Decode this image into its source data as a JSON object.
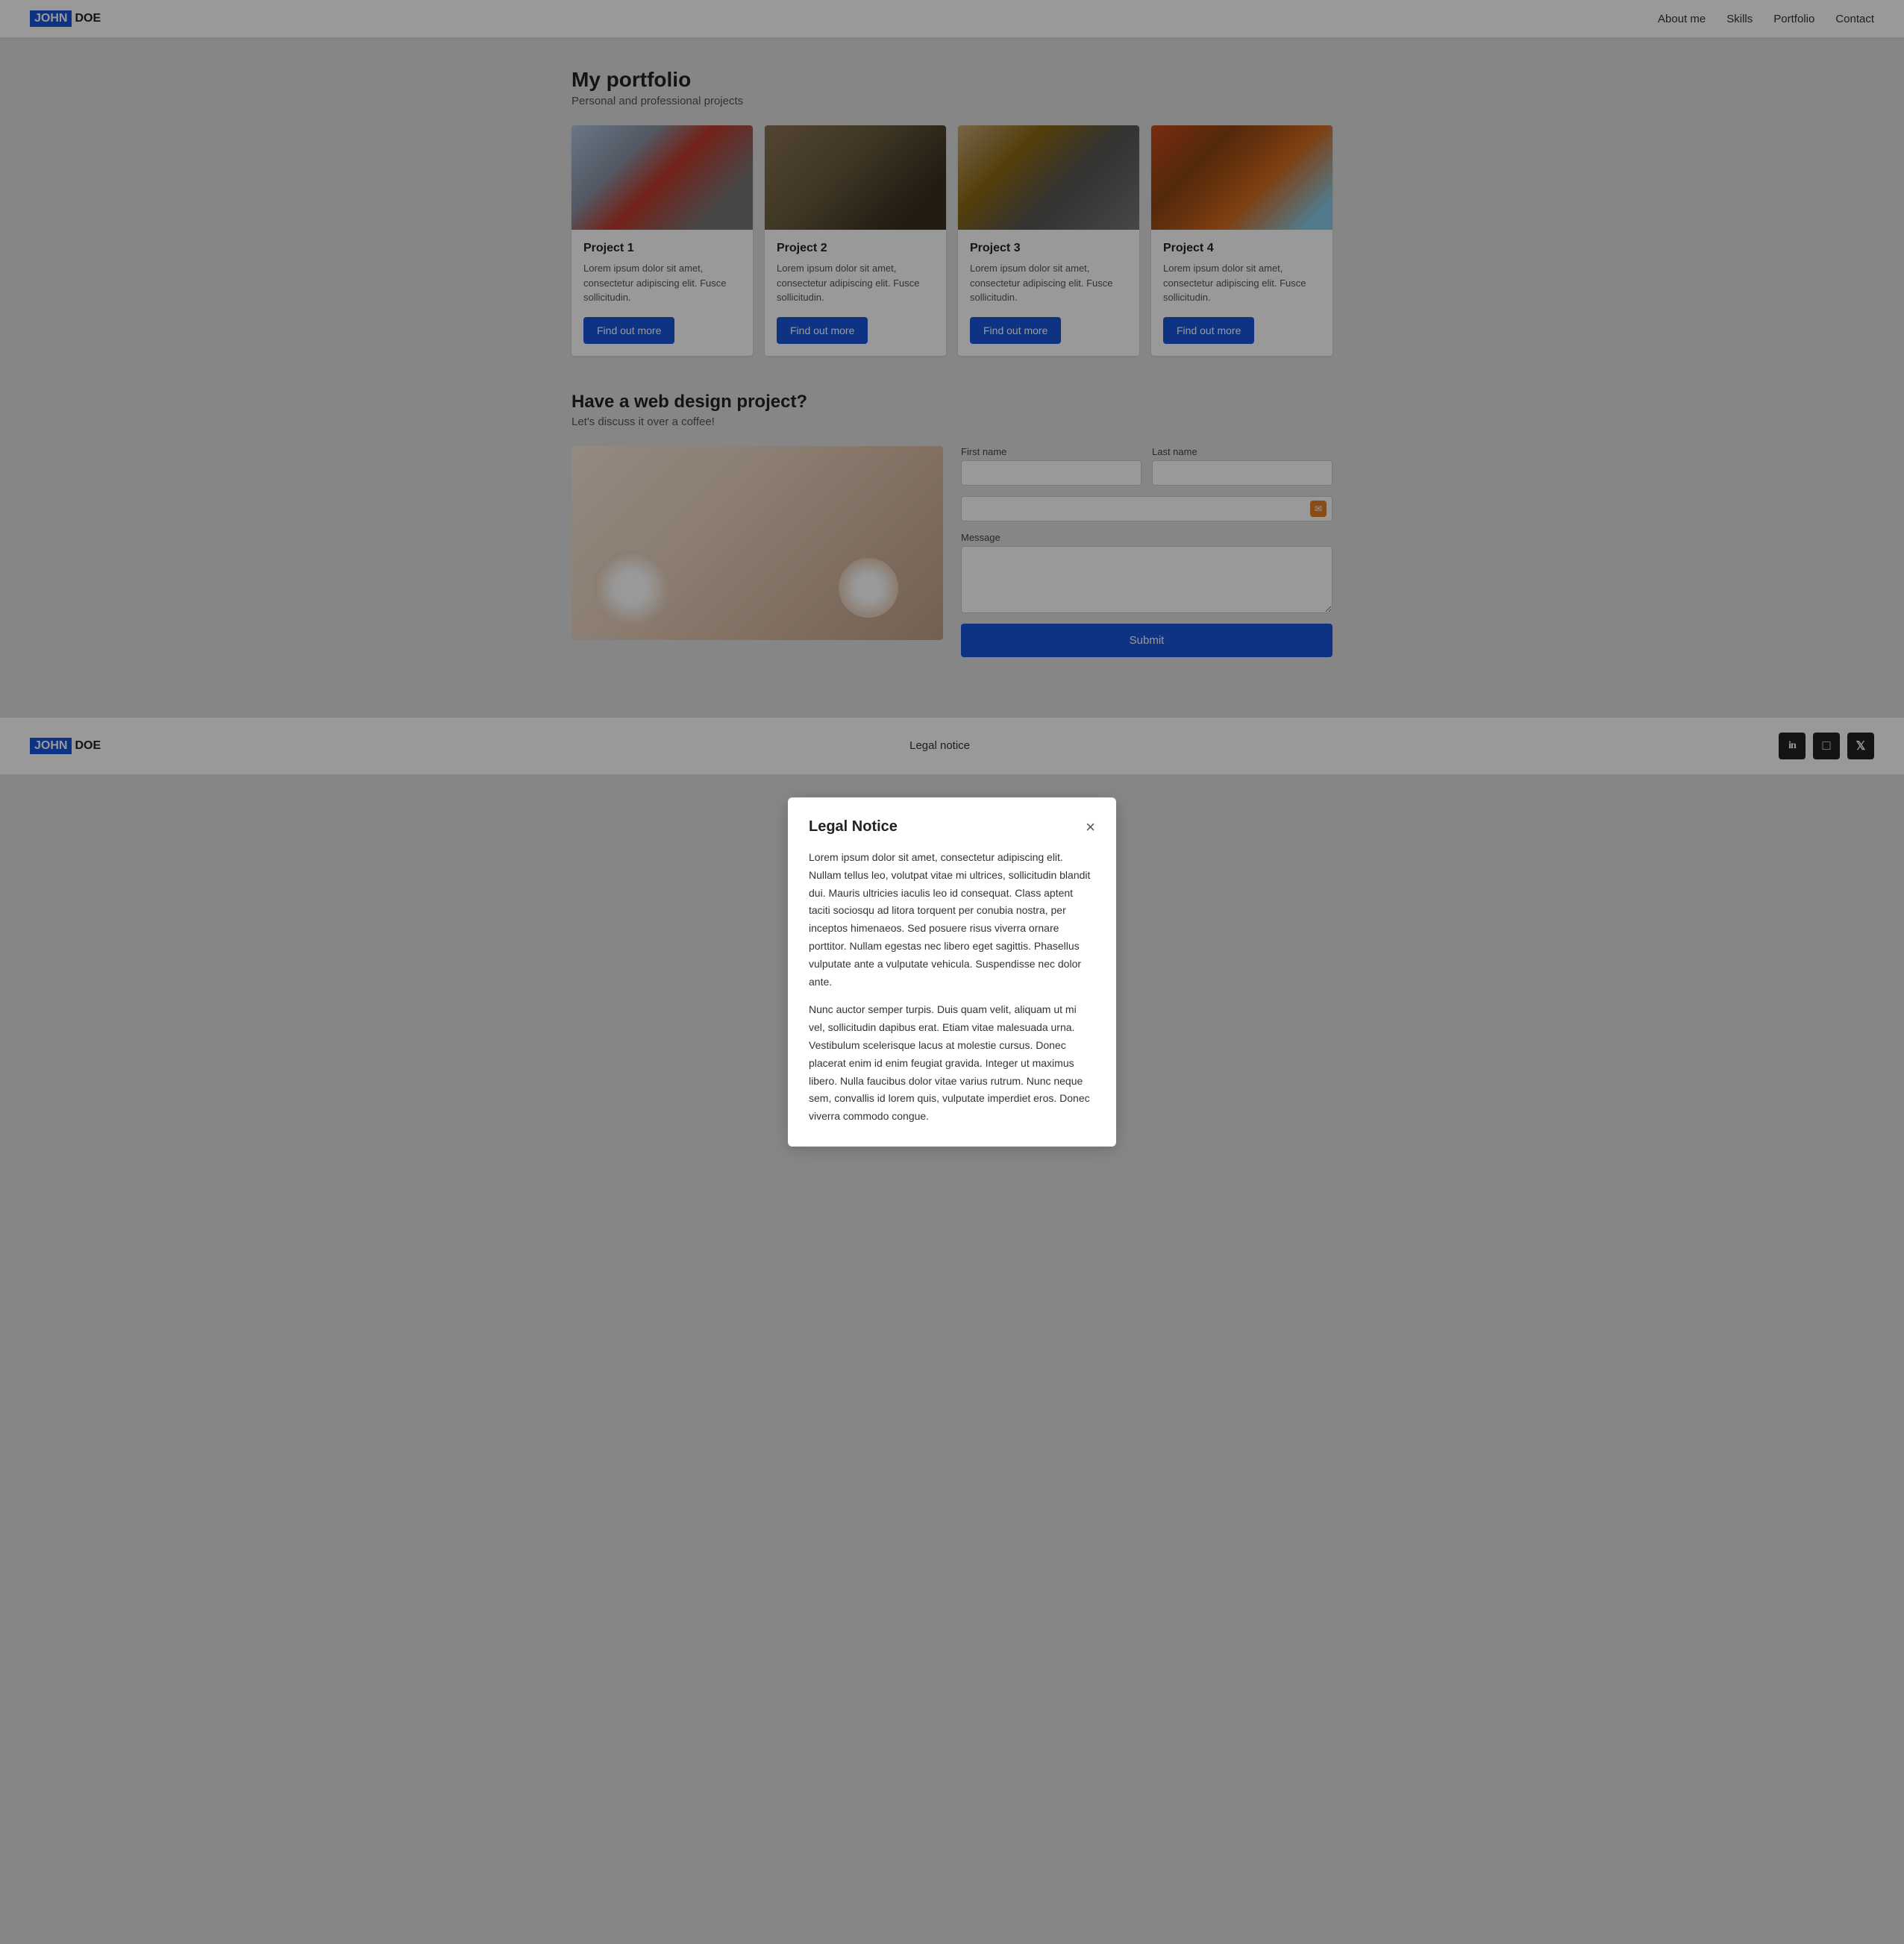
{
  "header": {
    "logo_john": "JOHN",
    "logo_doe": "DOE",
    "nav": [
      {
        "label": "About me",
        "href": "#"
      },
      {
        "label": "Skills",
        "href": "#"
      },
      {
        "label": "Portfolio",
        "href": "#"
      },
      {
        "label": "Contact",
        "href": "#"
      }
    ]
  },
  "portfolio": {
    "title": "My portfolio",
    "subtitle": "Personal and professional projects",
    "projects": [
      {
        "id": "project-1",
        "title": "Project 1",
        "desc": "Lorem ipsum dolor sit amet, consectetur adipiscing elit. Fusce sollicitudin.",
        "button": "Find out more",
        "img_class": "img-1"
      },
      {
        "id": "project-2",
        "title": "Project 2",
        "desc": "Lorem ipsum dolor sit amet, consectetur adipiscing elit. Fusce sollicitudin.",
        "button": "Find out more",
        "img_class": "img-2"
      },
      {
        "id": "project-3",
        "title": "Project 3",
        "desc": "Lorem ipsum dolor sit amet, consectetur adipiscing elit. Fusce sollicitudin.",
        "button": "Find out more",
        "img_class": "img-3"
      },
      {
        "id": "project-4",
        "title": "Project 4",
        "desc": "Lorem ipsum dolor sit amet, consectetur adipiscing elit. Fusce sollicitudin.",
        "button": "Find out more",
        "img_class": "img-4"
      }
    ]
  },
  "contact": {
    "title": "Have a web design project?",
    "subtitle": "Let's discuss it over a coffee!",
    "form": {
      "first_name_label": "First name",
      "last_name_label": "Last name",
      "email_label": "Email",
      "message_label": "Message",
      "submit_label": "Submit"
    }
  },
  "footer": {
    "logo_john": "JOHN",
    "logo_doe": "DOE",
    "legal_notice": "Legal notice",
    "social": [
      {
        "name": "linkedin",
        "icon": "in"
      },
      {
        "name": "instagram",
        "icon": "📷"
      },
      {
        "name": "twitter",
        "icon": "🐦"
      }
    ]
  },
  "modal": {
    "title": "Legal Notice",
    "close_label": "×",
    "paragraph1": "Lorem ipsum dolor sit amet, consectetur adipiscing elit. Nullam tellus leo, volutpat vitae mi ultrices, sollicitudin blandit dui. Mauris ultricies iaculis leo id consequat. Class aptent taciti sociosqu ad litora torquent per conubia nostra, per inceptos himenaeos. Sed posuere risus viverra ornare porttitor. Nullam egestas nec libero eget sagittis. Phasellus vulputate ante a vulputate vehicula. Suspendisse nec dolor ante.",
    "paragraph2": "Nunc auctor semper turpis. Duis quam velit, aliquam ut mi vel, sollicitudin dapibus erat. Etiam vitae malesuada urna. Vestibulum scelerisque lacus at molestie cursus. Donec placerat enim id enim feugiat gravida. Integer ut maximus libero. Nulla faucibus dolor vitae varius rutrum. Nunc neque sem, convallis id lorem quis, vulputate imperdiet eros. Donec viverra commodo congue."
  }
}
